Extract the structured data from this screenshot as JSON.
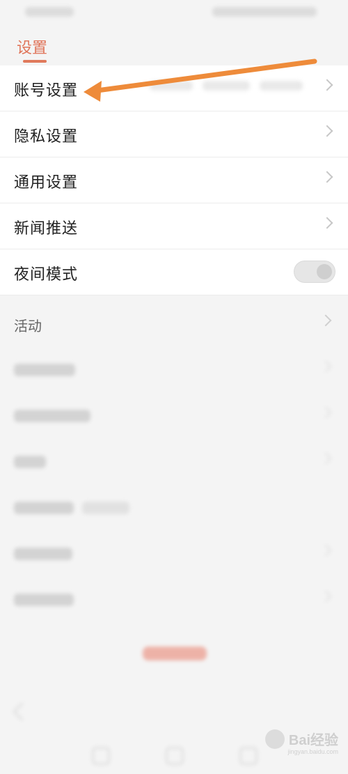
{
  "header": {
    "title": "设置"
  },
  "settings": [
    {
      "label": "账号设置"
    },
    {
      "label": "隐私设置"
    },
    {
      "label": "通用设置"
    },
    {
      "label": "新闻推送"
    },
    {
      "label": "夜间模式"
    }
  ],
  "section2": {
    "first_label": "活动"
  },
  "annotation": {
    "arrow_color": "#EE8B3A"
  },
  "watermark": {
    "brand": "Bai经验",
    "url": "jingyan.baidu.com"
  }
}
